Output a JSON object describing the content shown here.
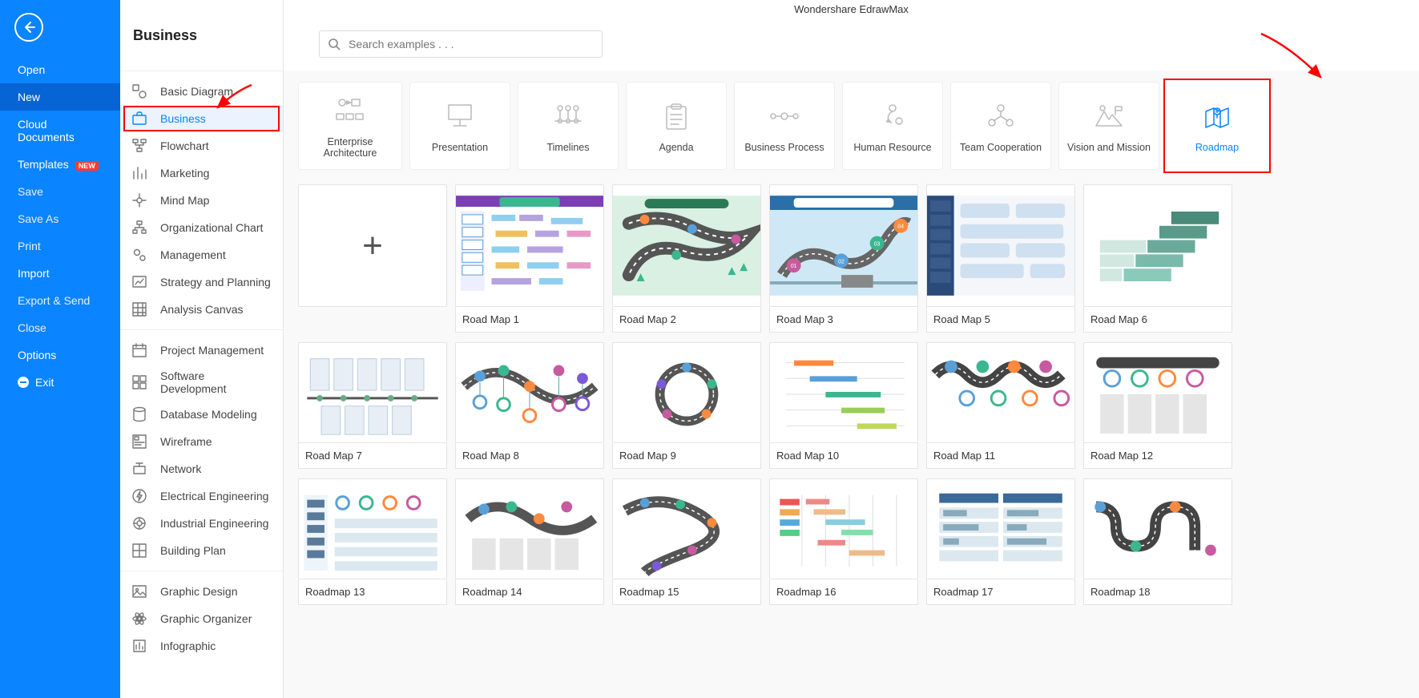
{
  "app_title": "Wondershare EdrawMax",
  "nav": {
    "items": [
      {
        "label": "Open",
        "style": "strong"
      },
      {
        "label": "New",
        "style": "hl strong"
      },
      {
        "label": "Cloud Documents",
        "style": "strong"
      },
      {
        "label": "Templates",
        "style": "strong",
        "badge": "NEW"
      },
      {
        "label": "Save"
      },
      {
        "label": "Save As"
      },
      {
        "label": "Print"
      },
      {
        "label": "Import",
        "style": "strong"
      },
      {
        "label": "Export & Send"
      },
      {
        "label": "Close"
      },
      {
        "label": "Options",
        "style": "strong"
      },
      {
        "label": "Exit",
        "style": "strong",
        "exit": true
      }
    ]
  },
  "sidebar": {
    "heading": "Business",
    "groups": [
      [
        {
          "label": "Basic Diagram",
          "icon": "shapes"
        },
        {
          "label": "Business",
          "icon": "briefcase",
          "selected": true,
          "highlight": true
        },
        {
          "label": "Flowchart",
          "icon": "flow"
        },
        {
          "label": "Marketing",
          "icon": "bars"
        },
        {
          "label": "Mind Map",
          "icon": "mind"
        },
        {
          "label": "Organizational Chart",
          "icon": "org"
        },
        {
          "label": "Management",
          "icon": "gears"
        },
        {
          "label": "Strategy and Planning",
          "icon": "chart"
        },
        {
          "label": "Analysis Canvas",
          "icon": "grid"
        }
      ],
      [
        {
          "label": "Project Management",
          "icon": "calendar"
        },
        {
          "label": "Software Development",
          "icon": "boxes"
        },
        {
          "label": "Database Modeling",
          "icon": "db"
        },
        {
          "label": "Wireframe",
          "icon": "wire"
        },
        {
          "label": "Network",
          "icon": "net"
        },
        {
          "label": "Electrical Engineering",
          "icon": "bolt"
        },
        {
          "label": "Industrial Engineering",
          "icon": "ind"
        },
        {
          "label": "Building Plan",
          "icon": "plan"
        }
      ],
      [
        {
          "label": "Graphic Design",
          "icon": "image"
        },
        {
          "label": "Graphic Organizer",
          "icon": "atom"
        },
        {
          "label": "Infographic",
          "icon": "info"
        }
      ]
    ]
  },
  "search": {
    "placeholder": "Search examples . . ."
  },
  "tiles": [
    {
      "label": "Enterprise Architecture",
      "icon": "ea"
    },
    {
      "label": "Presentation",
      "icon": "screen"
    },
    {
      "label": "Timelines",
      "icon": "timeline"
    },
    {
      "label": "Agenda",
      "icon": "clip"
    },
    {
      "label": "Business Process",
      "icon": "dots"
    },
    {
      "label": "Human Resource",
      "icon": "people"
    },
    {
      "label": "Team Cooperation",
      "icon": "team"
    },
    {
      "label": "Vision and Mission",
      "icon": "mountain"
    },
    {
      "label": "Roadmap",
      "icon": "map",
      "active": true,
      "highlight": true
    }
  ],
  "templates": [
    {
      "label": "",
      "blank": true
    },
    {
      "label": "Road Map 1"
    },
    {
      "label": "Road Map 2"
    },
    {
      "label": "Road Map 3"
    },
    {
      "label": "Road Map 5"
    },
    {
      "label": "Road Map 6"
    },
    {
      "label": "Road Map 7"
    },
    {
      "label": "Road Map 8"
    },
    {
      "label": "Road Map 9"
    },
    {
      "label": "Road Map 10"
    },
    {
      "label": "Road Map 11"
    },
    {
      "label": "Road Map 12"
    },
    {
      "label": "Roadmap 13"
    },
    {
      "label": "Roadmap 14"
    },
    {
      "label": "Roadmap 15"
    },
    {
      "label": "Roadmap 16"
    },
    {
      "label": "Roadmap 17"
    },
    {
      "label": "Roadmap 18"
    }
  ]
}
